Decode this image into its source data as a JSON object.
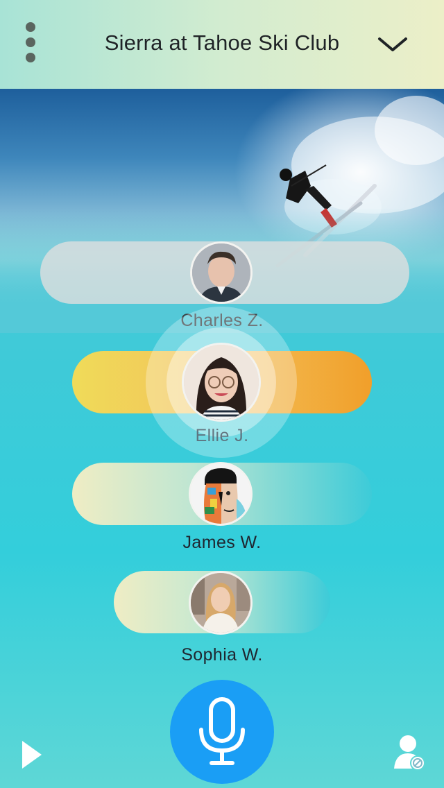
{
  "header": {
    "title": "Sierra at Tahoe Ski Club",
    "menu_icon": "vertical-dots-icon",
    "dropdown_icon": "chevron-down-icon"
  },
  "hero": {
    "image": "skier-jump-photo"
  },
  "members": [
    {
      "name": "Charles Z.",
      "state": "idle",
      "avatar": "portrait-young-man"
    },
    {
      "name": "Ellie J.",
      "state": "speaking",
      "avatar": "portrait-woman-glasses"
    },
    {
      "name": "James W.",
      "state": "idle",
      "avatar": "portrait-artistic-face"
    },
    {
      "name": "Sophia W.",
      "state": "idle",
      "avatar": "portrait-woman-city"
    }
  ],
  "controls": {
    "play_icon": "play-icon",
    "mic_icon": "microphone-icon",
    "user_block_icon": "user-blocked-icon"
  },
  "colors": {
    "speaking_pill_start": "#f0db59",
    "speaking_pill_end": "#f19f2a",
    "mic_button": "#1a9ef5",
    "background_teal": "#33cedb"
  }
}
